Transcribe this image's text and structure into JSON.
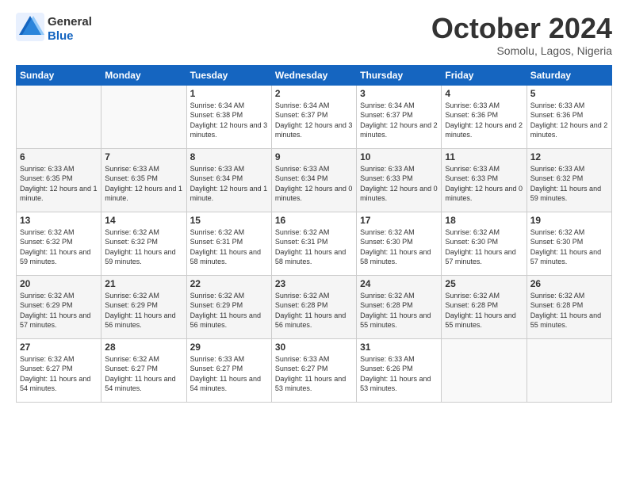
{
  "header": {
    "logo_general": "General",
    "logo_blue": "Blue",
    "month_title": "October 2024",
    "subtitle": "Somolu, Lagos, Nigeria"
  },
  "weekdays": [
    "Sunday",
    "Monday",
    "Tuesday",
    "Wednesday",
    "Thursday",
    "Friday",
    "Saturday"
  ],
  "weeks": [
    [
      {
        "day": "",
        "sunrise": "",
        "sunset": "",
        "daylight": ""
      },
      {
        "day": "",
        "sunrise": "",
        "sunset": "",
        "daylight": ""
      },
      {
        "day": "1",
        "sunrise": "Sunrise: 6:34 AM",
        "sunset": "Sunset: 6:38 PM",
        "daylight": "Daylight: 12 hours and 3 minutes."
      },
      {
        "day": "2",
        "sunrise": "Sunrise: 6:34 AM",
        "sunset": "Sunset: 6:37 PM",
        "daylight": "Daylight: 12 hours and 3 minutes."
      },
      {
        "day": "3",
        "sunrise": "Sunrise: 6:34 AM",
        "sunset": "Sunset: 6:37 PM",
        "daylight": "Daylight: 12 hours and 2 minutes."
      },
      {
        "day": "4",
        "sunrise": "Sunrise: 6:33 AM",
        "sunset": "Sunset: 6:36 PM",
        "daylight": "Daylight: 12 hours and 2 minutes."
      },
      {
        "day": "5",
        "sunrise": "Sunrise: 6:33 AM",
        "sunset": "Sunset: 6:36 PM",
        "daylight": "Daylight: 12 hours and 2 minutes."
      }
    ],
    [
      {
        "day": "6",
        "sunrise": "Sunrise: 6:33 AM",
        "sunset": "Sunset: 6:35 PM",
        "daylight": "Daylight: 12 hours and 1 minute."
      },
      {
        "day": "7",
        "sunrise": "Sunrise: 6:33 AM",
        "sunset": "Sunset: 6:35 PM",
        "daylight": "Daylight: 12 hours and 1 minute."
      },
      {
        "day": "8",
        "sunrise": "Sunrise: 6:33 AM",
        "sunset": "Sunset: 6:34 PM",
        "daylight": "Daylight: 12 hours and 1 minute."
      },
      {
        "day": "9",
        "sunrise": "Sunrise: 6:33 AM",
        "sunset": "Sunset: 6:34 PM",
        "daylight": "Daylight: 12 hours and 0 minutes."
      },
      {
        "day": "10",
        "sunrise": "Sunrise: 6:33 AM",
        "sunset": "Sunset: 6:33 PM",
        "daylight": "Daylight: 12 hours and 0 minutes."
      },
      {
        "day": "11",
        "sunrise": "Sunrise: 6:33 AM",
        "sunset": "Sunset: 6:33 PM",
        "daylight": "Daylight: 12 hours and 0 minutes."
      },
      {
        "day": "12",
        "sunrise": "Sunrise: 6:33 AM",
        "sunset": "Sunset: 6:32 PM",
        "daylight": "Daylight: 11 hours and 59 minutes."
      }
    ],
    [
      {
        "day": "13",
        "sunrise": "Sunrise: 6:32 AM",
        "sunset": "Sunset: 6:32 PM",
        "daylight": "Daylight: 11 hours and 59 minutes."
      },
      {
        "day": "14",
        "sunrise": "Sunrise: 6:32 AM",
        "sunset": "Sunset: 6:32 PM",
        "daylight": "Daylight: 11 hours and 59 minutes."
      },
      {
        "day": "15",
        "sunrise": "Sunrise: 6:32 AM",
        "sunset": "Sunset: 6:31 PM",
        "daylight": "Daylight: 11 hours and 58 minutes."
      },
      {
        "day": "16",
        "sunrise": "Sunrise: 6:32 AM",
        "sunset": "Sunset: 6:31 PM",
        "daylight": "Daylight: 11 hours and 58 minutes."
      },
      {
        "day": "17",
        "sunrise": "Sunrise: 6:32 AM",
        "sunset": "Sunset: 6:30 PM",
        "daylight": "Daylight: 11 hours and 58 minutes."
      },
      {
        "day": "18",
        "sunrise": "Sunrise: 6:32 AM",
        "sunset": "Sunset: 6:30 PM",
        "daylight": "Daylight: 11 hours and 57 minutes."
      },
      {
        "day": "19",
        "sunrise": "Sunrise: 6:32 AM",
        "sunset": "Sunset: 6:30 PM",
        "daylight": "Daylight: 11 hours and 57 minutes."
      }
    ],
    [
      {
        "day": "20",
        "sunrise": "Sunrise: 6:32 AM",
        "sunset": "Sunset: 6:29 PM",
        "daylight": "Daylight: 11 hours and 57 minutes."
      },
      {
        "day": "21",
        "sunrise": "Sunrise: 6:32 AM",
        "sunset": "Sunset: 6:29 PM",
        "daylight": "Daylight: 11 hours and 56 minutes."
      },
      {
        "day": "22",
        "sunrise": "Sunrise: 6:32 AM",
        "sunset": "Sunset: 6:29 PM",
        "daylight": "Daylight: 11 hours and 56 minutes."
      },
      {
        "day": "23",
        "sunrise": "Sunrise: 6:32 AM",
        "sunset": "Sunset: 6:28 PM",
        "daylight": "Daylight: 11 hours and 56 minutes."
      },
      {
        "day": "24",
        "sunrise": "Sunrise: 6:32 AM",
        "sunset": "Sunset: 6:28 PM",
        "daylight": "Daylight: 11 hours and 55 minutes."
      },
      {
        "day": "25",
        "sunrise": "Sunrise: 6:32 AM",
        "sunset": "Sunset: 6:28 PM",
        "daylight": "Daylight: 11 hours and 55 minutes."
      },
      {
        "day": "26",
        "sunrise": "Sunrise: 6:32 AM",
        "sunset": "Sunset: 6:28 PM",
        "daylight": "Daylight: 11 hours and 55 minutes."
      }
    ],
    [
      {
        "day": "27",
        "sunrise": "Sunrise: 6:32 AM",
        "sunset": "Sunset: 6:27 PM",
        "daylight": "Daylight: 11 hours and 54 minutes."
      },
      {
        "day": "28",
        "sunrise": "Sunrise: 6:32 AM",
        "sunset": "Sunset: 6:27 PM",
        "daylight": "Daylight: 11 hours and 54 minutes."
      },
      {
        "day": "29",
        "sunrise": "Sunrise: 6:33 AM",
        "sunset": "Sunset: 6:27 PM",
        "daylight": "Daylight: 11 hours and 54 minutes."
      },
      {
        "day": "30",
        "sunrise": "Sunrise: 6:33 AM",
        "sunset": "Sunset: 6:27 PM",
        "daylight": "Daylight: 11 hours and 53 minutes."
      },
      {
        "day": "31",
        "sunrise": "Sunrise: 6:33 AM",
        "sunset": "Sunset: 6:26 PM",
        "daylight": "Daylight: 11 hours and 53 minutes."
      },
      {
        "day": "",
        "sunrise": "",
        "sunset": "",
        "daylight": ""
      },
      {
        "day": "",
        "sunrise": "",
        "sunset": "",
        "daylight": ""
      }
    ]
  ]
}
